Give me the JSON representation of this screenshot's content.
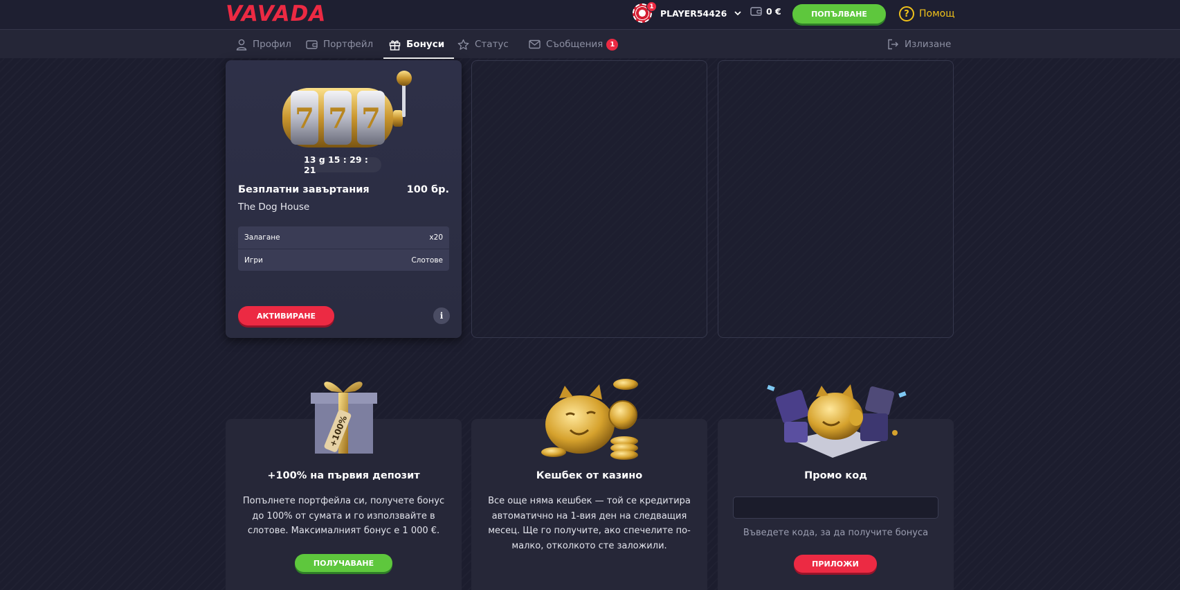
{
  "brand": {
    "logo_text": "VAVADA",
    "logo_color": "#ec2a43"
  },
  "header": {
    "avatar_badge": "1",
    "username": "PLAYER54426",
    "balance": "0 €",
    "deposit_label": "ПОПЪЛВАНЕ",
    "help_label": "Помощ"
  },
  "nav": {
    "profile": "Профил",
    "wallet": "Портфейл",
    "bonuses": "Бонуси",
    "status": "Статус",
    "messages": "Съобщения",
    "messages_badge": "1",
    "logout": "Излизане"
  },
  "bonus_card": {
    "timer": "13 g 15 : 29 : 21",
    "title": "Безплатни завъртания",
    "amount": "100 бр.",
    "game": "The Dog House",
    "terms": [
      {
        "label": "Залагане",
        "value": "x20"
      },
      {
        "label": "Игри",
        "value": "Слотове"
      }
    ],
    "activate_label": "АКТИВИРАНЕ",
    "info_label": "i"
  },
  "promos": {
    "deposit": {
      "title": "+100% на първия депозит",
      "text": "Попълнете портфейла си, получете бонус до 100% от сумата и го използвайте в слотове. Максималният бонус е 1 000 €.",
      "button": "ПОЛУЧАВАНЕ",
      "gift_tag": "+100%"
    },
    "cashback": {
      "title": "Кешбек от казино",
      "text": "Все още няма кешбек — той се кредитира автоматично на 1-вия ден на следващия месец. Ще го получите, ако спечелите по-малко, отколкото сте заложили."
    },
    "promo_code": {
      "title": "Промо код",
      "input_value": "",
      "hint": "Въведете кода, за да получите бонуса",
      "button": "ПРИЛОЖИ"
    }
  },
  "colors": {
    "accent_red": "#ec2a43",
    "accent_green": "#5ec73d",
    "help_yellow": "#f0c21b",
    "background": "#1c1d2e"
  }
}
